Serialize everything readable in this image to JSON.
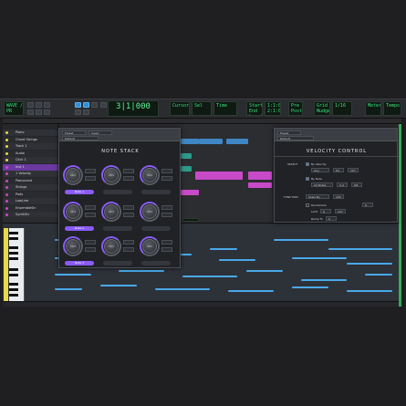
{
  "app": {
    "accent": "#8a5cf6",
    "lcd_color": "#3be37a"
  },
  "transport": {
    "counter": "3|1|000",
    "lcd_left": "WAVE / SETT\nPR",
    "lcd_right_1": "Start\nEnd\nLength",
    "lcd_right_2": "Pre\nPost",
    "lcd_right_3": "1:1:000\n2:1:000",
    "lcd_right_4": "Grid\nNudge"
  },
  "tracks": {
    "items": [
      {
        "name": "Piano",
        "color": "#e8d84a"
      },
      {
        "name": "Chord Strings",
        "color": "#e8d84a"
      },
      {
        "name": "Track 1",
        "color": "#e8d84a"
      },
      {
        "name": "Audio",
        "color": "#e8d84a"
      },
      {
        "name": "Click 1",
        "color": "#e8d84a"
      },
      {
        "name": "Inst 1",
        "color": "#c84ac8"
      },
      {
        "name": "1 Velocity",
        "color": "#c84ac8"
      },
      {
        "name": "PianoLead",
        "color": "#c84ac8"
      },
      {
        "name": "Strings",
        "color": "#c84ac8"
      },
      {
        "name": "Pads",
        "color": "#c84ac8"
      },
      {
        "name": "LowLine",
        "color": "#c84ac8"
      },
      {
        "name": "EnsembleStr",
        "color": "#c84ac8"
      },
      {
        "name": "SynthStr",
        "color": "#c84ac8"
      }
    ]
  },
  "note_stack": {
    "title": "NOTE STACK",
    "knob_label": "Ctrl",
    "btn_labels": [
      "Note 1",
      "Note 2",
      "Note 3"
    ],
    "rows": [
      {
        "left": "Note 1",
        "right": "Note 2"
      },
      {
        "left": "Note 3",
        "right": "Note 4"
      },
      {
        "left": "Note 5",
        "right": "Note 6"
      }
    ]
  },
  "velocity_control": {
    "title": "VELOCITY CONTROL",
    "select_label": "SELECT",
    "by_velocity": "By Velocity",
    "by_note": "By Note",
    "all_notes": "All Notes",
    "function_label": "FUNCTION",
    "function_value": "Scale By",
    "randomize": "Randomize",
    "limit_label": "Limit",
    "ramp_label": "Ramp To",
    "val_a": "127",
    "val_b": "100",
    "val_c": "64"
  }
}
